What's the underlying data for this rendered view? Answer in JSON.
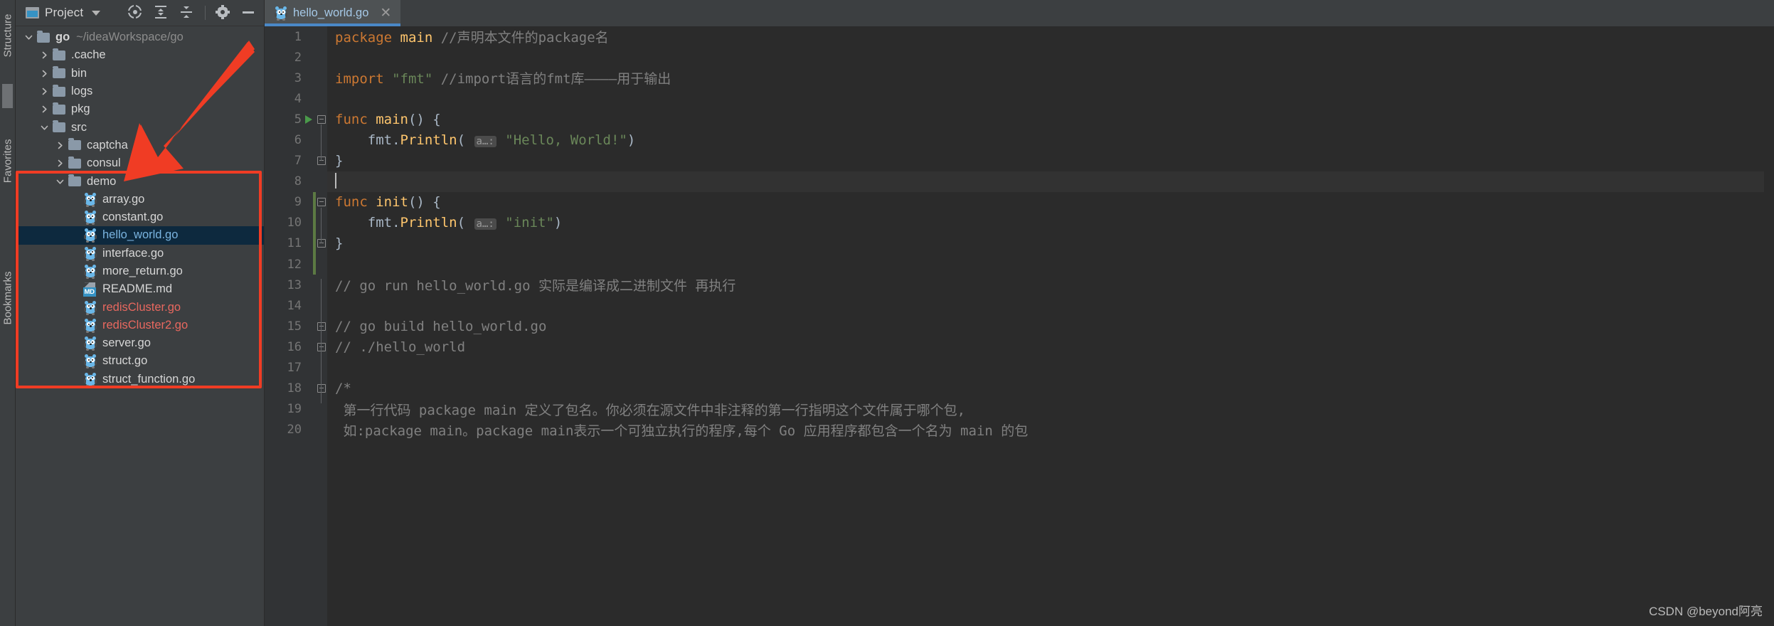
{
  "toolstrip": {
    "items": [
      {
        "label": "Structure",
        "icon": "structure-icon"
      },
      {
        "label": "Favorites",
        "icon": "favorites-icon"
      },
      {
        "label": "Bookmarks",
        "icon": "bookmarks-icon"
      }
    ]
  },
  "sidebar": {
    "title": "Project",
    "title_icon": "project-panel-icon",
    "dropdown_icon": "chevron-down-icon",
    "actions": [
      {
        "name": "select-opened-file",
        "icon": "target-icon",
        "label": "Select Opened File"
      },
      {
        "name": "expand-all",
        "icon": "expand-all-icon",
        "label": "Expand All"
      },
      {
        "name": "collapse-all",
        "icon": "collapse-all-icon",
        "label": "Collapse All"
      },
      {
        "name": "settings",
        "icon": "gear-icon",
        "label": "Settings"
      },
      {
        "name": "hide",
        "icon": "minimize-icon",
        "label": "Hide"
      }
    ],
    "tree": [
      {
        "label": "go",
        "path": "~/ideaWorkspace/go",
        "icon": "folder-icon",
        "indent": 0,
        "twisty": "expanded",
        "bold": true,
        "color": "default"
      },
      {
        "label": ".cache",
        "path": "",
        "icon": "folder-icon",
        "indent": 1,
        "twisty": "collapsed",
        "bold": false,
        "color": "default"
      },
      {
        "label": "bin",
        "path": "",
        "icon": "folder-icon",
        "indent": 1,
        "twisty": "collapsed",
        "bold": false,
        "color": "default"
      },
      {
        "label": "logs",
        "path": "",
        "icon": "folder-icon",
        "indent": 1,
        "twisty": "collapsed",
        "bold": false,
        "color": "default"
      },
      {
        "label": "pkg",
        "path": "",
        "icon": "folder-icon",
        "indent": 1,
        "twisty": "collapsed",
        "bold": false,
        "color": "default"
      },
      {
        "label": "src",
        "path": "",
        "icon": "folder-icon",
        "indent": 1,
        "twisty": "expanded",
        "bold": false,
        "color": "default"
      },
      {
        "label": "captcha",
        "path": "",
        "icon": "folder-icon",
        "indent": 2,
        "twisty": "collapsed",
        "bold": false,
        "color": "default"
      },
      {
        "label": "consul",
        "path": "",
        "icon": "folder-icon",
        "indent": 2,
        "twisty": "collapsed",
        "bold": false,
        "color": "default"
      },
      {
        "label": "demo",
        "path": "",
        "icon": "folder-icon",
        "indent": 2,
        "twisty": "expanded",
        "bold": false,
        "color": "default"
      },
      {
        "label": "array.go",
        "path": "",
        "icon": "go-file-icon",
        "indent": 3,
        "twisty": "none",
        "bold": false,
        "color": "default"
      },
      {
        "label": "constant.go",
        "path": "",
        "icon": "go-file-icon",
        "indent": 3,
        "twisty": "none",
        "bold": false,
        "color": "default"
      },
      {
        "label": "hello_world.go",
        "path": "",
        "icon": "go-file-icon",
        "indent": 3,
        "twisty": "none",
        "bold": false,
        "color": "selected",
        "selected": true
      },
      {
        "label": "interface.go",
        "path": "",
        "icon": "go-file-icon",
        "indent": 3,
        "twisty": "none",
        "bold": false,
        "color": "default"
      },
      {
        "label": "more_return.go",
        "path": "",
        "icon": "go-file-icon",
        "indent": 3,
        "twisty": "none",
        "bold": false,
        "color": "default"
      },
      {
        "label": "README.md",
        "path": "",
        "icon": "markdown-file-icon",
        "indent": 3,
        "twisty": "none",
        "bold": false,
        "color": "default"
      },
      {
        "label": "redisCluster.go",
        "path": "",
        "icon": "go-file-icon",
        "indent": 3,
        "twisty": "none",
        "bold": false,
        "color": "red"
      },
      {
        "label": "redisCluster2.go",
        "path": "",
        "icon": "go-file-icon",
        "indent": 3,
        "twisty": "none",
        "bold": false,
        "color": "red"
      },
      {
        "label": "server.go",
        "path": "",
        "icon": "go-file-icon",
        "indent": 3,
        "twisty": "none",
        "bold": false,
        "color": "default"
      },
      {
        "label": "struct.go",
        "path": "",
        "icon": "go-file-icon",
        "indent": 3,
        "twisty": "none",
        "bold": false,
        "color": "default"
      },
      {
        "label": "struct_function.go",
        "path": "",
        "icon": "go-file-icon",
        "indent": 3,
        "twisty": "none",
        "bold": false,
        "color": "default"
      }
    ]
  },
  "editor": {
    "tabs": [
      {
        "label": "hello_world.go",
        "icon": "go-file-icon",
        "close_icon": "close-icon",
        "active": true
      }
    ],
    "lines": [
      {
        "n": 1,
        "run": false,
        "fold": "none",
        "vcs": false,
        "caret": false,
        "tokens": [
          {
            "t": "package ",
            "c": "kw"
          },
          {
            "t": "main",
            "c": "fn"
          },
          {
            "t": " //声明本文件的package名",
            "c": "cmt"
          }
        ]
      },
      {
        "n": 2,
        "run": false,
        "fold": "none",
        "vcs": false,
        "caret": false,
        "tokens": []
      },
      {
        "n": 3,
        "run": false,
        "fold": "none",
        "vcs": false,
        "caret": false,
        "tokens": [
          {
            "t": "import ",
            "c": "kw"
          },
          {
            "t": "\"fmt\"",
            "c": "str"
          },
          {
            "t": " //import语言的fmt库————用于输出",
            "c": "cmt"
          }
        ]
      },
      {
        "n": 4,
        "run": false,
        "fold": "none",
        "vcs": false,
        "caret": false,
        "tokens": []
      },
      {
        "n": 5,
        "run": true,
        "fold": "start",
        "vcs": false,
        "caret": false,
        "tokens": [
          {
            "t": "func ",
            "c": "kw"
          },
          {
            "t": "main",
            "c": "fn"
          },
          {
            "t": "() {",
            "c": "plain"
          }
        ]
      },
      {
        "n": 6,
        "run": false,
        "fold": "mid",
        "vcs": false,
        "caret": false,
        "tokens": [
          {
            "t": "    fmt",
            "c": "plain"
          },
          {
            "t": ".",
            "c": "plain"
          },
          {
            "t": "Println",
            "c": "fn"
          },
          {
            "t": "( ",
            "c": "plain"
          },
          {
            "t": "a…:",
            "c": "hint"
          },
          {
            "t": " ",
            "c": "plain"
          },
          {
            "t": "\"Hello, World!\"",
            "c": "str"
          },
          {
            "t": ")",
            "c": "plain"
          }
        ]
      },
      {
        "n": 7,
        "run": false,
        "fold": "end",
        "vcs": false,
        "caret": false,
        "tokens": [
          {
            "t": "}",
            "c": "plain"
          }
        ]
      },
      {
        "n": 8,
        "run": false,
        "fold": "none",
        "vcs": false,
        "caret": true,
        "tokens": []
      },
      {
        "n": 9,
        "run": false,
        "fold": "start",
        "vcs": true,
        "caret": false,
        "tokens": [
          {
            "t": "func ",
            "c": "kw"
          },
          {
            "t": "init",
            "c": "fn"
          },
          {
            "t": "() {",
            "c": "plain"
          }
        ]
      },
      {
        "n": 10,
        "run": false,
        "fold": "mid",
        "vcs": true,
        "caret": false,
        "tokens": [
          {
            "t": "    fmt",
            "c": "plain"
          },
          {
            "t": ".",
            "c": "plain"
          },
          {
            "t": "Println",
            "c": "fn"
          },
          {
            "t": "( ",
            "c": "plain"
          },
          {
            "t": "a…:",
            "c": "hint"
          },
          {
            "t": " ",
            "c": "plain"
          },
          {
            "t": "\"init\"",
            "c": "str"
          },
          {
            "t": ")",
            "c": "plain"
          }
        ]
      },
      {
        "n": 11,
        "run": false,
        "fold": "end",
        "vcs": true,
        "caret": false,
        "tokens": [
          {
            "t": "}",
            "c": "plain"
          }
        ]
      },
      {
        "n": 12,
        "run": false,
        "fold": "none",
        "vcs": true,
        "caret": false,
        "tokens": []
      },
      {
        "n": 13,
        "run": false,
        "fold": "none",
        "vcs": false,
        "caret": false,
        "tokens": [
          {
            "t": "// go run hello_world.go 实际是编译成二进制文件 再执行",
            "c": "cmt"
          }
        ]
      },
      {
        "n": 14,
        "run": false,
        "fold": "none",
        "vcs": false,
        "caret": false,
        "tokens": []
      },
      {
        "n": 15,
        "run": false,
        "fold": "start",
        "vcs": false,
        "caret": false,
        "tokens": [
          {
            "t": "// go build hello_world.go",
            "c": "cmt"
          }
        ]
      },
      {
        "n": 16,
        "run": false,
        "fold": "end",
        "vcs": false,
        "caret": false,
        "tokens": [
          {
            "t": "// ./hello_world",
            "c": "cmt"
          }
        ]
      },
      {
        "n": 17,
        "run": false,
        "fold": "none",
        "vcs": false,
        "caret": false,
        "tokens": []
      },
      {
        "n": 18,
        "run": false,
        "fold": "start",
        "vcs": false,
        "caret": false,
        "tokens": [
          {
            "t": "/*",
            "c": "cmt"
          }
        ]
      },
      {
        "n": 19,
        "run": false,
        "fold": "mid",
        "vcs": false,
        "caret": false,
        "tokens": [
          {
            "t": " 第一行代码 package main 定义了包名。你必须在源文件中非注释的第一行指明这个文件属于哪个包,",
            "c": "cmt"
          }
        ]
      },
      {
        "n": 20,
        "run": false,
        "fold": "mid",
        "vcs": false,
        "caret": false,
        "tokens": [
          {
            "t": " 如:package main。package main表示一个可独立执行的程序,每个 Go 应用程序都包含一个名为 main 的包",
            "c": "cmt"
          }
        ]
      }
    ]
  },
  "annotations": {
    "arrow_color": "#f03c24",
    "rect_color": "#f03c24",
    "watermark": "CSDN @beyond阿亮"
  }
}
